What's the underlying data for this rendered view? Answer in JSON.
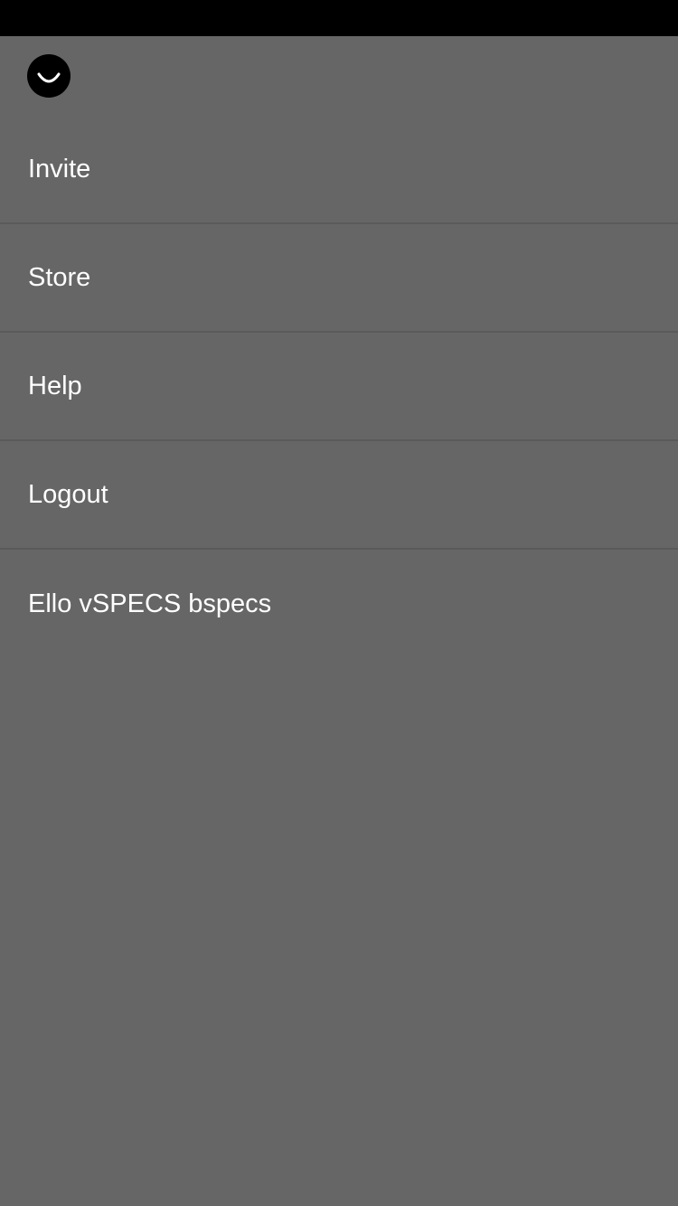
{
  "app": {
    "logo_icon": "ello-smile-logo-icon"
  },
  "menu": {
    "items": [
      {
        "label": "Invite"
      },
      {
        "label": "Store"
      },
      {
        "label": "Help"
      },
      {
        "label": "Logout"
      }
    ]
  },
  "footer": {
    "version_text": "Ello vSPECS bspecs"
  },
  "colors": {
    "status_bar": "#000000",
    "background": "#666666",
    "divider": "#5a5a5a",
    "text": "#ffffff"
  }
}
